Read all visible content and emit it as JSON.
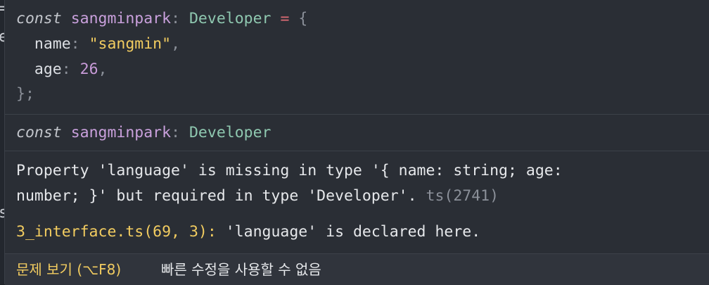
{
  "editor_strip": {
    "glyph_top": "=",
    "glyph_mid": "e",
    "glyph_bottom": "s"
  },
  "code_block": {
    "line1": {
      "keyword": "const",
      "variable": "sangminpark",
      "colon": ":",
      "type": "Developer",
      "equals": "=",
      "brace": "{"
    },
    "line2": {
      "prop": "name",
      "colon": ":",
      "value": "\"sangmin\"",
      "comma": ","
    },
    "line3": {
      "prop": "age",
      "colon": ":",
      "value": "26",
      "comma": ","
    },
    "line4": {
      "close": "};"
    }
  },
  "hover": {
    "signature": {
      "keyword": "const",
      "variable": "sangminpark",
      "colon": ":",
      "type": "Developer"
    },
    "error_line1": "Property 'language' is missing in type '{ name: string; age:",
    "error_line2": "number; }' but required in type 'Developer'.",
    "error_code": "ts(2741)",
    "related_location": "3_interface.ts(69, 3):",
    "related_message": "'language' is declared here."
  },
  "actions": {
    "view_problem": "문제 보기 (⌥F8)",
    "quick_fix": "빠른 수정을 사용할 수 없음"
  }
}
